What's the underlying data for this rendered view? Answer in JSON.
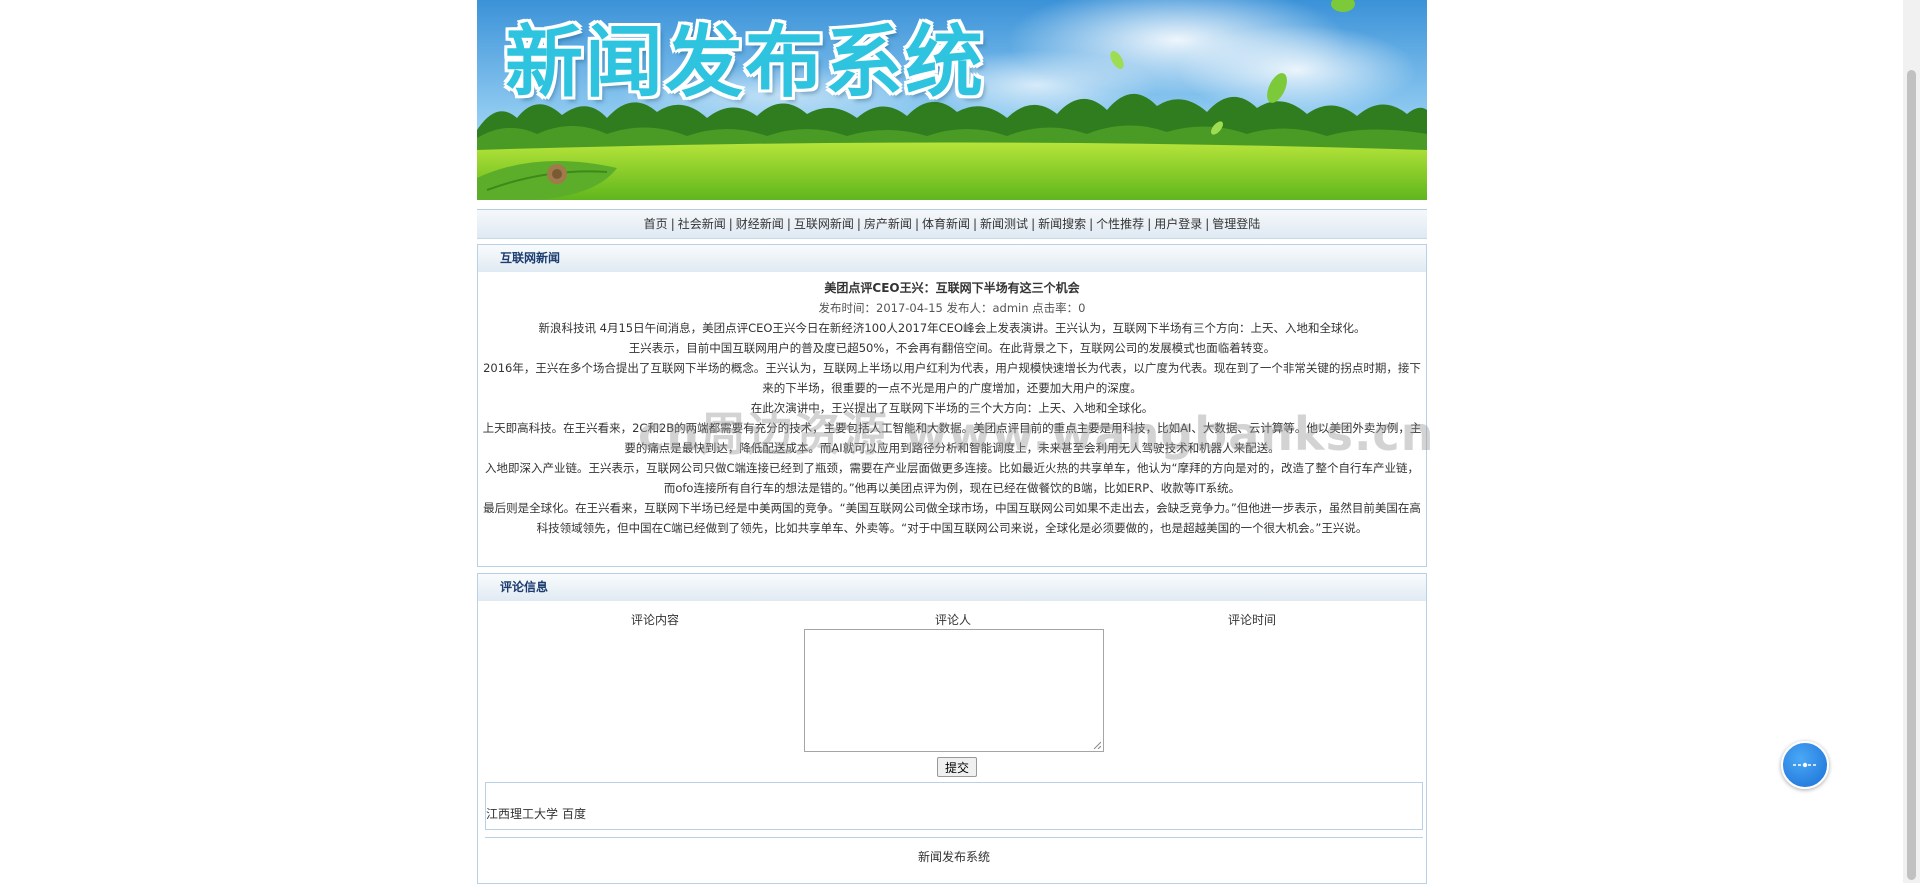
{
  "site": {
    "title": "新闻发布系统"
  },
  "nav": {
    "items": [
      "首页",
      "社会新闻",
      "财经新闻",
      "互联网新闻",
      "房产新闻",
      "体育新闻",
      "新闻测试",
      "新闻搜索",
      "个性推荐",
      "用户登录",
      "管理登陆"
    ]
  },
  "news_section": {
    "heading": "互联网新闻",
    "article": {
      "title": "美团点评CEO王兴：互联网下半场有这三个机会",
      "meta": "发布时间：2017-04-15 发布人：admin 点击率：0",
      "paragraphs": [
        "新浪科技讯 4月15日午间消息，美团点评CEO王兴今日在新经济100人2017年CEO峰会上发表演讲。王兴认为，互联网下半场有三个方向：上天、入地和全球化。",
        "王兴表示，目前中国互联网用户的普及度已超50%，不会再有翻倍空间。在此背景之下，互联网公司的发展模式也面临着转变。",
        "2016年，王兴在多个场合提出了互联网下半场的概念。王兴认为，互联网上半场以用户红利为代表，用户规模快速增长为代表，以广度为代表。现在到了一个非常关键的拐点时期，接下来的下半场，很重要的一点不光是用户的广度增加，还要加大用户的深度。",
        "在此次演讲中，王兴提出了互联网下半场的三个大方向：上天、入地和全球化。",
        "上天即高科技。在王兴看来，2C和2B的两端都需要有充分的技术，主要包括人工智能和大数据。美团点评目前的重点主要是用科技，比如AI、大数据、云计算等。他以美团外卖为例，主要的痛点是最快到达，降低配送成本。而AI就可以应用到路径分析和智能调度上，未来甚至会利用无人驾驶技术和机器人来配送。",
        "入地即深入产业链。王兴表示，互联网公司只做C端连接已经到了瓶颈，需要在产业层面做更多连接。比如最近火热的共享单车，他认为“摩拜的方向是对的，改造了整个自行车产业链，而ofo连接所有自行车的想法是错的。”他再以美团点评为例，现在已经在做餐饮的B端，比如ERP、收款等IT系统。",
        "最后则是全球化。在王兴看来，互联网下半场已经是中美两国的竞争。“美国互联网公司做全球市场，中国互联网公司如果不走出去，会缺乏竞争力。”但他进一步表示，虽然目前美国在高科技领域领先，但中国在C端已经做到了领先，比如共享单车、外卖等。“对于中国互联网公司来说，全球化是必须要做的，也是超越美国的一个很大机会。”王兴说。"
      ]
    }
  },
  "comments": {
    "heading": "评论信息",
    "columns": [
      "评论内容",
      "评论人",
      "评论时间"
    ],
    "textarea_value": "",
    "submit_label": "提交"
  },
  "friend_links": [
    "江西理工大学",
    "百度"
  ],
  "footer": {
    "text": "新闻发布系统"
  },
  "watermark": "cn周边资源 www.wangbanks.cn",
  "colors": {
    "title_cyan": "#2ec4e0",
    "panel_border": "#b8d1e6",
    "heading_navy": "#1d3c70",
    "float_blue": "#1a6fd6"
  }
}
